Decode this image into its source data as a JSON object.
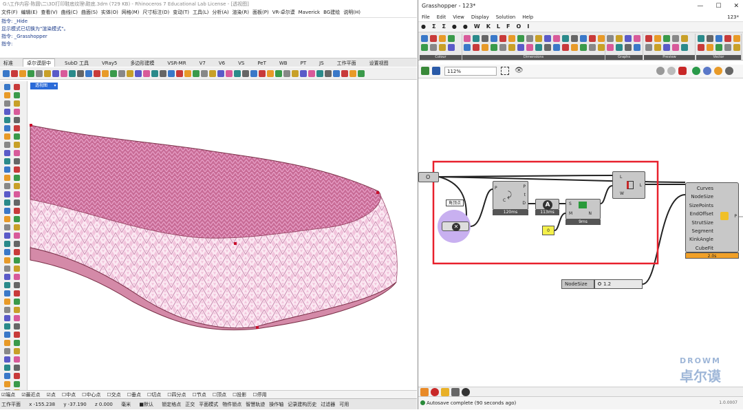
{
  "rhino": {
    "title": "G:\\工作内容-陈圆\\二\\3D打印鞋底纹理\\鞋底.3dm (729 KB) - Rhinoceros 7 Educational Lab License - [透视图]",
    "menu": [
      "文件(F)",
      "编辑(E)",
      "查看(V)",
      "曲线(C)",
      "曲面(S)",
      "实体(O)",
      "网格(M)",
      "尺寸标注(D)",
      "变动(T)",
      "工具(L)",
      "分析(A)",
      "渲染(R)",
      "面板(P)",
      "VR-卓尔谟",
      "Maverick",
      "BG建绘",
      "说明(H)"
    ],
    "command_history": [
      "指令: _Hide",
      "显示模式已切换为\"渲染模式\"。",
      "指令: _Grasshopper",
      "指令:"
    ],
    "tabs": [
      "标准",
      "卓尔谟厨中",
      "SubD 工具",
      "VRay5",
      "多边形建模",
      "VSR-MR",
      "V7",
      "V6",
      "VS",
      "PeT",
      "WB",
      "PT",
      "JS",
      "工作平面",
      "设置视图"
    ],
    "active_tab_index": 1,
    "viewport_label": "透视图",
    "viewport_arrow": "▾",
    "osnaps": [
      "☑端点",
      "☑最近点",
      "☑点",
      "☐中点",
      "☐中心点",
      "☐交点",
      "☐垂点",
      "☐切点",
      "☐四分点",
      "☐节点",
      "☐顶点",
      "☐投影",
      "☐停用"
    ],
    "status": {
      "plane": "工作平面",
      "x": "x -155.238",
      "y": "y -37.190",
      "z": "z 0.000",
      "unit": "毫米",
      "layer": "■默认",
      "toggles": [
        "锁定格点",
        "正交",
        "平面模式",
        "物件锁点",
        "智慧轨迹",
        "操作轴",
        "记录建构历史",
        "过滤器",
        "可用"
      ]
    }
  },
  "grasshopper": {
    "title": "Grasshopper - 123*",
    "win_buttons": [
      "—",
      "☐",
      "✕"
    ],
    "menu": [
      "File",
      "Edit",
      "View",
      "Display",
      "Solution",
      "Help"
    ],
    "doc_name": "123*",
    "tabs": [
      "●",
      "Σ",
      "Σ",
      "●",
      "●",
      "W",
      "K",
      "L",
      "F",
      "O",
      "I"
    ],
    "ribbon_groups": [
      "Colour",
      "Dimensions",
      "Graphs",
      "Preview",
      "Vector"
    ],
    "zoom": "112%",
    "nodes": {
      "input_label": "O",
      "point_group_label": "角顶点",
      "comp1": {
        "pins_left": [
          "P",
          "C"
        ],
        "pins_right": [
          "P",
          "t",
          "D"
        ],
        "time": "120ms"
      },
      "comp2": {
        "time": "113ms",
        "glyph": "A"
      },
      "comp3": {
        "pins_left": [
          "S",
          "M"
        ],
        "pins_right": [
          "N"
        ],
        "time": "9ms"
      },
      "comp4": {
        "pins_left": [
          "L",
          "W"
        ],
        "pins_right": [
          "L"
        ]
      },
      "slider_value": "0",
      "big_inputs": [
        "Curves",
        "NodeSize",
        "SizePoints",
        "EndOffset",
        "StrutSize",
        "Segment",
        "KinkAngle",
        "CubeFit"
      ],
      "big_output": "P",
      "big_time": "2.0s",
      "nodesize_label": "NodeSize",
      "nodesize_value": "1.2"
    },
    "status": "Autosave complete (90 seconds ago)",
    "version": "1.0.0007"
  },
  "watermark": {
    "line1": "DROWM",
    "line2": "卓尔谟"
  },
  "colors": {
    "sole_pink": "#e8a0c8",
    "sole_top": "#c86c96",
    "selection_red": "#e8202c",
    "gh_gray": "#c8c8c8"
  }
}
